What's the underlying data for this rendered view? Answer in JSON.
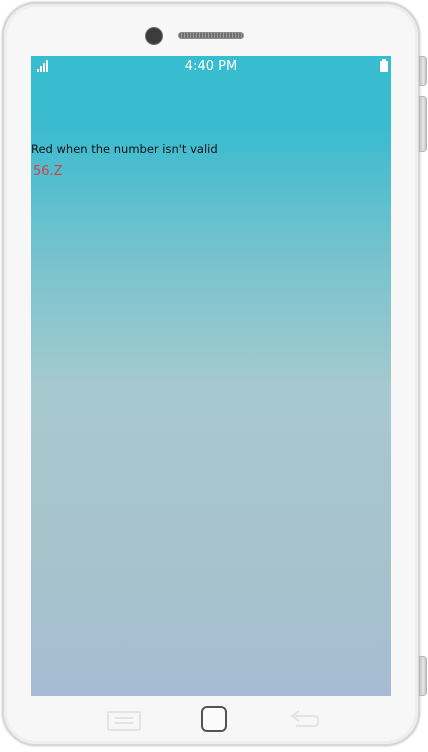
{
  "status_bar": {
    "time": "4:40 PM",
    "signal_icon": "signal-bars-icon",
    "battery_icon": "battery-icon",
    "text_color": "#ffffff"
  },
  "content": {
    "label": "Red when the number isn't valid",
    "entry_value": "56.Z",
    "entry_invalid_color": "#d0414c"
  },
  "navigation": {
    "menu_icon": "menu-icon",
    "home_icon": "home-icon",
    "back_icon": "back-arrow-icon"
  },
  "theme": {
    "gradient_top": "#38bcd0",
    "gradient_bottom": "#a7bcd2",
    "device_frame": "#f7f7f7"
  }
}
